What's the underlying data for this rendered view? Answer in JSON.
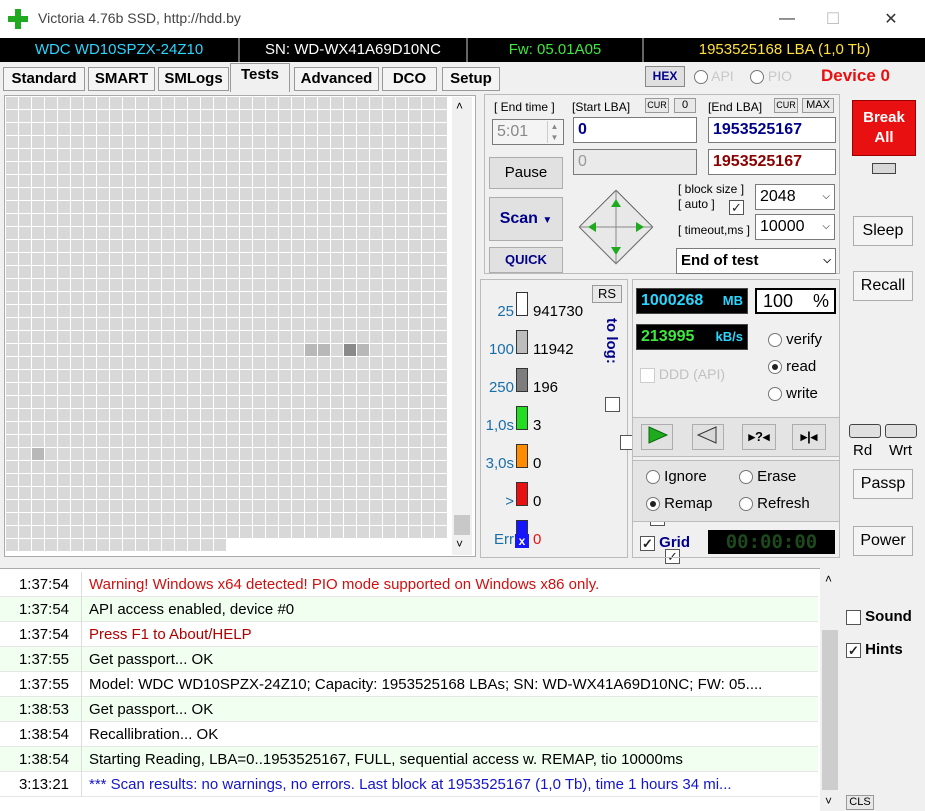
{
  "window": {
    "title": "Victoria 4.76b SSD, http://hdd.by",
    "minimize": "—",
    "maximize": "☐",
    "close": "✕"
  },
  "info": {
    "model": "WDC WD10SPZX-24Z10",
    "serial": "SN: WD-WX41A69D10NC",
    "firmware": "Fw: 05.01A05",
    "capacity": "1953525168 LBA (1,0 Tb)"
  },
  "tabs": [
    "Standard",
    "SMART",
    "SMLogs",
    "Tests",
    "Advanced",
    "DCO",
    "Setup"
  ],
  "mode": {
    "hex": "HEX",
    "api": "API",
    "pio": "PIO",
    "device": "Device 0"
  },
  "test": {
    "end_time_label": "[ End time ]",
    "end_time": "5:01",
    "start_lba_label": "[Start LBA]",
    "cur": "CUR",
    "zero": "0",
    "end_lba_label": "[End LBA]",
    "max": "MAX",
    "start_lba": "0",
    "end_lba": "1953525167",
    "cur_lba": "0",
    "cur_end_lba": "1953525167",
    "pause": "Pause",
    "scan": "Scan",
    "quick": "QUICK",
    "block_size_label": "[ block size ]",
    "auto_label": "[ auto ]",
    "block_size": "2048",
    "timeout_label": "[ timeout,ms ]",
    "timeout": "10000",
    "end_action": "End of test"
  },
  "stats": {
    "rs": "RS",
    "to_log": "to log:",
    "rows": [
      {
        "label": "25",
        "count": "941730",
        "color": "#ffffff",
        "checked": false,
        "show_chk": false
      },
      {
        "label": "100",
        "count": "11942",
        "color": "#bdbdbd",
        "checked": false,
        "show_chk": false
      },
      {
        "label": "250",
        "count": "196",
        "color": "#7d7d7d",
        "checked": false,
        "show_chk": true
      },
      {
        "label": "1,0s",
        "count": "3",
        "color": "#22dd22",
        "checked": false,
        "show_chk": true
      },
      {
        "label": "3,0s",
        "count": "0",
        "color": "#ff8c00",
        "checked": true,
        "show_chk": true
      },
      {
        "label": ">",
        "count": "0",
        "color": "#e81010",
        "checked": true,
        "show_chk": true
      },
      {
        "label": "Err",
        "count": "0",
        "color": "#1515ff",
        "checked": true,
        "show_chk": true
      }
    ],
    "err_mark": "x"
  },
  "progress": {
    "mb": "1000268",
    "mb_unit": "MB",
    "percent": "100",
    "percent_unit": "%",
    "speed": "213995",
    "speed_unit": "kB/s",
    "ddd": "DDD (API)",
    "verify": "verify",
    "read": "read",
    "write": "write",
    "ignore": "Ignore",
    "erase": "Erase",
    "remap": "Remap",
    "refresh": "Refresh",
    "grid": "Grid",
    "timer": "00:00:00"
  },
  "side": {
    "break": "Break All",
    "sleep": "Sleep",
    "recall": "Recall",
    "rd": "Rd",
    "wrt": "Wrt",
    "passp": "Passp",
    "power": "Power",
    "sound": "Sound",
    "hints": "Hints",
    "cls": "CLS"
  },
  "log": [
    {
      "time": "1:37:54",
      "msg": "Warning! Windows x64 detected! PIO mode supported on Windows x86 only.",
      "color": "#d01010"
    },
    {
      "time": "1:37:54",
      "msg": "API access enabled, device #0",
      "color": "#000000"
    },
    {
      "time": "1:37:54",
      "msg": "Press F1 to About/HELP",
      "color": "#b00000"
    },
    {
      "time": "1:37:55",
      "msg": "Get passport... OK",
      "color": "#000000"
    },
    {
      "time": "1:37:55",
      "msg": "Model: WDC WD10SPZX-24Z10; Capacity: 1953525168 LBAs; SN: WD-WX41A69D10NC; FW: 05....",
      "color": "#000000"
    },
    {
      "time": "1:38:53",
      "msg": "Get passport... OK",
      "color": "#000000"
    },
    {
      "time": "1:38:54",
      "msg": "Recallibration... OK",
      "color": "#000000"
    },
    {
      "time": "1:38:54",
      "msg": "Starting Reading, LBA=0..1953525167, FULL, sequential access w. REMAP, tio 10000ms",
      "color": "#000000"
    },
    {
      "time": "3:13:21",
      "msg": "*** Scan results: no warnings, no errors. Last block at 1953525167 (1,0 Tb), time 1 hours 34 mi...",
      "color": "#1515cc"
    }
  ]
}
